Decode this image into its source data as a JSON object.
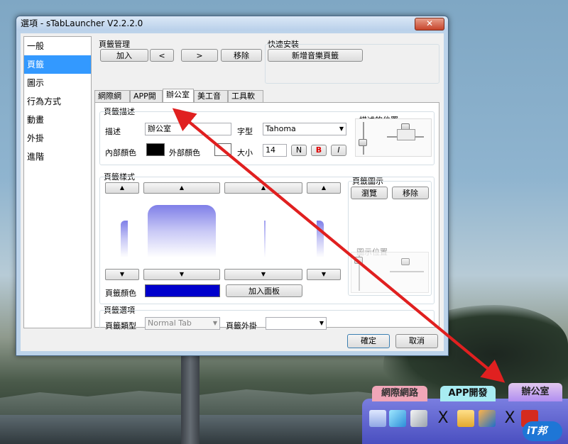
{
  "window": {
    "title": "選項 - sTabLauncher V2.2.2.0",
    "close": "✕"
  },
  "sidebar": {
    "items": [
      "一般",
      "頁籤",
      "圖示",
      "行為方式",
      "動畫",
      "外掛",
      "進階"
    ]
  },
  "tab_management": {
    "label": "頁籤管理",
    "add": "加入",
    "prev": "<",
    "next": ">",
    "remove": "移除"
  },
  "quick_install": {
    "label": "快速安裝",
    "add_music_tab": "新增音樂頁籤"
  },
  "tabs": [
    "網際網路",
    "APP開發",
    "辦公室",
    "美工音樂",
    "工具軟體"
  ],
  "desc_section": {
    "label": "頁籤描述",
    "desc_label": "描述",
    "desc_value": "辦公室",
    "font_label": "字型",
    "font_value": "Tahoma",
    "inner_color_label": "內部顏色",
    "outer_color_label": "外部顏色",
    "size_label": "大小",
    "size_value": "14",
    "bold_n": "N",
    "bold_b": "B",
    "italic_i": "I",
    "position_label": "描述的位置"
  },
  "style_section": {
    "label": "頁籤樣式",
    "icon_label": "頁籤圖示",
    "browse": "瀏覽",
    "remove": "移除",
    "icon_position_label": "圖示位置",
    "color_label": "頁籤顏色",
    "add_panel": "加入面板",
    "up": "▲",
    "down": "▼"
  },
  "options_section": {
    "label": "頁籤選項",
    "type_label": "頁籤類型",
    "type_value": "Normal Tab",
    "plugin_label": "頁籤外掛",
    "plugin_value": ""
  },
  "footer": {
    "ok": "確定",
    "cancel": "取消"
  },
  "dock": {
    "tabs": [
      "網際網路",
      "APP開發",
      "辦公室"
    ]
  },
  "logo": {
    "text": "iT邦"
  },
  "colors": {
    "inner_color": "#000000",
    "outer_color": "#ffffff",
    "tab_color": "#0000cc",
    "accent": "#3399ff",
    "arrow": "#e02020"
  }
}
